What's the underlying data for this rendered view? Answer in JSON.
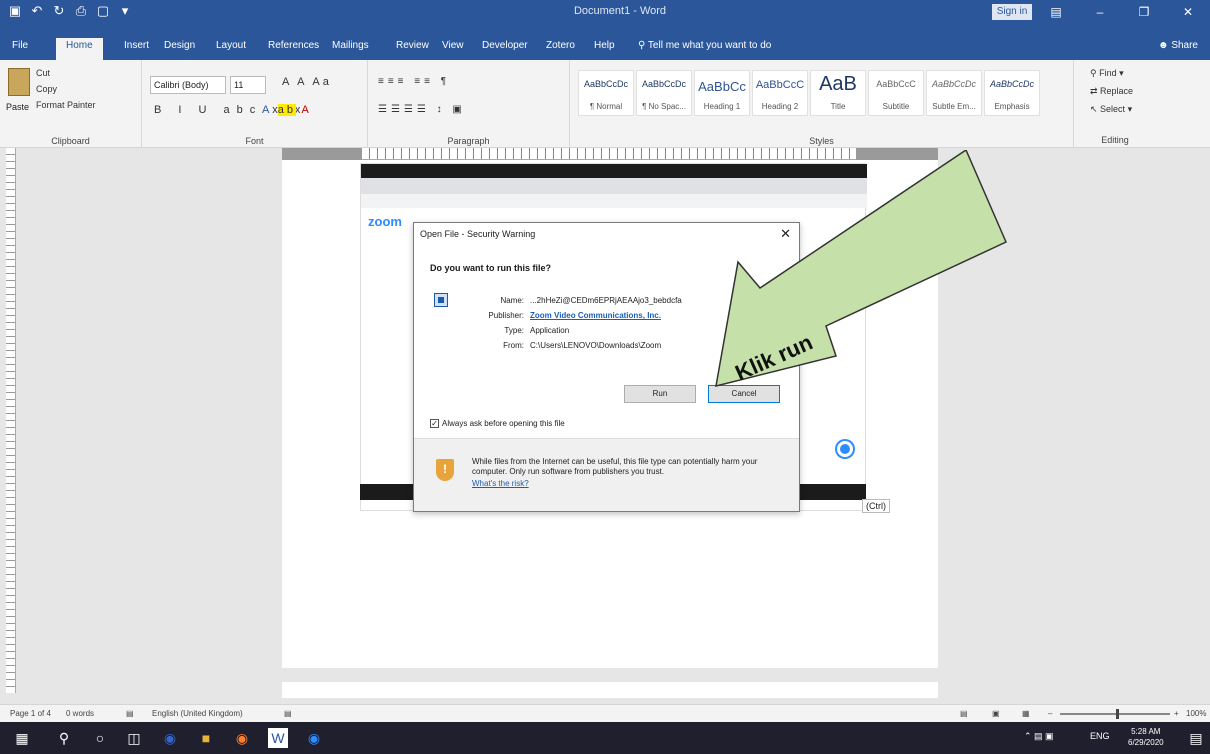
{
  "window": {
    "doc_title": "Document1 - Word",
    "sign_in": "Sign in"
  },
  "tabs": [
    {
      "label": "File"
    },
    {
      "label": "Home"
    },
    {
      "label": "Insert"
    },
    {
      "label": "Design"
    },
    {
      "label": "Layout"
    },
    {
      "label": "References"
    },
    {
      "label": "Mailings"
    },
    {
      "label": "Review"
    },
    {
      "label": "View"
    },
    {
      "label": "Developer"
    },
    {
      "label": "Zotero"
    },
    {
      "label": "Help"
    }
  ],
  "tell_me": "Tell me what you want to do",
  "share": "Share",
  "ribbon": {
    "clipboard": {
      "paste": "Paste",
      "cut": "Cut",
      "copy": "Copy",
      "format_painter": "Format Painter",
      "label": "Clipboard"
    },
    "font": {
      "name": "Calibri (Body)",
      "size": "11",
      "label": "Font"
    },
    "paragraph": {
      "label": "Paragraph"
    },
    "styles": {
      "label": "Styles",
      "items": [
        {
          "sample": "AaBbCcDc",
          "name": "¶ Normal"
        },
        {
          "sample": "AaBbCcDc",
          "name": "¶ No Spac..."
        },
        {
          "sample": "AaBbCc",
          "name": "Heading 1"
        },
        {
          "sample": "AaBbCcC",
          "name": "Heading 2"
        },
        {
          "sample": "AaB",
          "name": "Title"
        },
        {
          "sample": "AaBbCcC",
          "name": "Subtitle"
        },
        {
          "sample": "AaBbCcDc",
          "name": "Subtle Em..."
        },
        {
          "sample": "AaBbCcDc",
          "name": "Emphasis"
        }
      ]
    },
    "editing": {
      "find": "Find",
      "replace": "Replace",
      "select": "Select",
      "label": "Editing"
    }
  },
  "embedded": {
    "zoom_logo": "zoom",
    "ctrl_tag": "(Ctrl)"
  },
  "dialog": {
    "title": "Open File - Security Warning",
    "question": "Do you want to run this file?",
    "rows": [
      {
        "k": "Name:",
        "v": "...2hHeZi@CEDm6EPRjAEAAjo3_bebdcfa"
      },
      {
        "k": "Publisher:",
        "v": "Zoom Video Communications, Inc."
      },
      {
        "k": "Type:",
        "v": "Application"
      },
      {
        "k": "From:",
        "v": "C:\\Users\\LENOVO\\Downloads\\Zoom"
      }
    ],
    "run": "Run",
    "cancel": "Cancel",
    "always_ask": "Always ask before opening this file",
    "warning": "While files from the Internet can be useful, this file type can potentially harm your computer. Only run software from publishers you trust.",
    "risk_link": "What's the risk?"
  },
  "annotation": {
    "text": "Klik run"
  },
  "status": {
    "page": "Page 1 of 4",
    "words": "0 words",
    "language": "English (United Kingdom)",
    "zoom": "100%"
  },
  "taskbar": {
    "lang": "ENG",
    "time": "5:28 AM",
    "date": "6/29/2020"
  }
}
